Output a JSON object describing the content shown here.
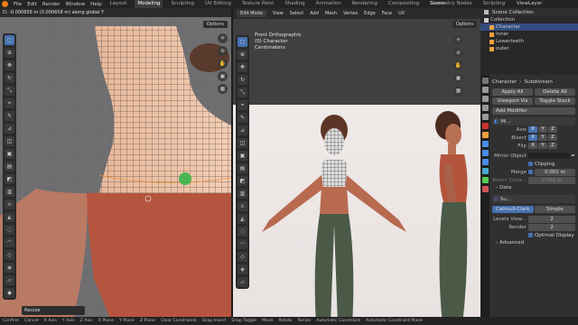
{
  "topbar": {
    "menu": [
      "File",
      "Edit",
      "Render",
      "Window",
      "Help"
    ],
    "workspaces": [
      "Layout",
      "Modeling",
      "Sculpting",
      "UV Editing",
      "Texture Paint",
      "Shading",
      "Animation",
      "Rendering",
      "Compositing",
      "Geometry Nodes",
      "Scripting"
    ],
    "active_workspace": "Modeling",
    "scene": "Scene",
    "view_layer": "ViewLayer"
  },
  "left_viewport": {
    "header": "D: -0.000658 m (0.000658 m) along global Y",
    "options": "Options",
    "resize_label": "Resize"
  },
  "right_viewport": {
    "mode": "Edit Mode",
    "menu": [
      "View",
      "Select",
      "Add",
      "Mesh",
      "Vertex",
      "Edge",
      "Face",
      "UV"
    ],
    "info": [
      "Front Orthographic",
      "(0) Character",
      "Centimeters"
    ],
    "options": "Options"
  },
  "outliner": {
    "title": "Scene Collection",
    "items": [
      "Collection",
      "Character",
      "Inner",
      "Lowerteeth",
      "outer"
    ]
  },
  "properties": {
    "object": "Character",
    "modifier_name": "Subdivision",
    "apply_all": "Apply All",
    "delete_all": "Delete All",
    "viewport_vis": "Viewport Vis",
    "toggle_stack": "Toggle Stack",
    "add_modifier": "Add Modifier",
    "mirror": {
      "short": "Mi...",
      "axis_label": "Axis",
      "bisect_label": "Bisect",
      "flip_label": "Flip",
      "axes": [
        "X",
        "Y",
        "Z"
      ],
      "mirror_object_label": "Mirror Object",
      "clipping_label": "Clipping",
      "merge_label": "Merge",
      "merge_value": "0.001 m",
      "bisect_dist_label": "Bisect Dista...",
      "bisect_dist_value": "0.001 m",
      "data_label": "Data"
    },
    "subsurf": {
      "short": "Su...",
      "catmull": "Catmull-Clark",
      "simple": "Simple",
      "levels_label": "Levels View...",
      "levels_value": "2",
      "render_label": "Render",
      "render_value": "2",
      "optimal_label": "Optimal Display",
      "advanced_label": "Advanced"
    }
  },
  "statusbar": [
    "Confirm",
    "Cancel",
    "X Axis",
    "Y Axis",
    "Z Axis",
    "X Plane",
    "Y Plane",
    "Z Plane",
    "Clear Constraints",
    "Snap Invert",
    "Snap Toggle",
    "Move",
    "Rotate",
    "Resize",
    "Automatic Constraint",
    "Automatic Constraint Plane"
  ]
}
